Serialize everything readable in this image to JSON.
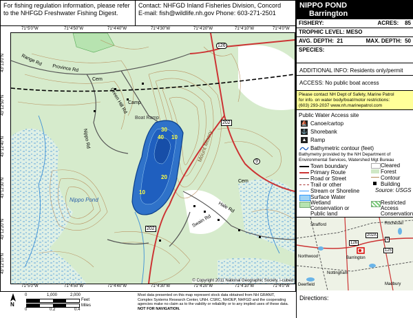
{
  "header": {
    "reg_line1": "For fishing regulation information, please refer",
    "reg_line2": "to the NHFGD Freshwater Fishing Digest.",
    "contact_line1": "Contact: NHFGD Inland Fisheries Division, Concord",
    "contact_line2": "E-mail: fish@wildlife.nh.gov Phone: 603-271-2501"
  },
  "pond": {
    "name": "NIPPO POND",
    "town": "Barrington",
    "fishery_label": "FISHERY:",
    "fishery_value": "",
    "acres_label": "ACRES:",
    "acres_value": "85",
    "trophic_label": "TROPHIC LEVEL:",
    "trophic_value": "MESO",
    "avg_depth_label": "AVG. DEPTH:",
    "avg_depth_value": "21",
    "max_depth_label": "MAX. DEPTH:",
    "max_depth_value": "50",
    "species_label": "SPECIES:"
  },
  "info": {
    "additional": "ADDITIONAL INFO: Residents only/permit",
    "access": "ACCESS: No public boat access",
    "safety_line1": "Please contact NH Dept of Safety, Marine Patrol",
    "safety_line2": "for info. on water body/boat/motor restrictions:",
    "safety_line3": "(603) 293-2037    www.nh.marinepatrol.com"
  },
  "legend": {
    "access_title": "Public Water Access site",
    "canoe": "Canoe/cartop",
    "shorebank": "Shorebank",
    "ramp": "Ramp",
    "bathy": "Bathymetric contour (feet)",
    "bathy_credit1": "Bathymetry provided by the NH Department of",
    "bathy_credit2": "Environmental Services, Watershed Mgt Bureau",
    "town_boundary": "Town boundary",
    "primary_route": "Primary Route",
    "road": "Road or Street",
    "trail": "Trail or other",
    "stream": "Stream or Shoreline",
    "surface_water": "Surface Water",
    "wetland1": "Wetland",
    "wetland2": "Conservation or",
    "wetland3": "Public land",
    "cleared": "Cleared",
    "forest": "Forest",
    "contour": "Contour",
    "building": "Building",
    "source": "Source: USGS",
    "restricted1": "Restricted",
    "restricted2": "Access",
    "restricted3": "Conservation"
  },
  "map": {
    "coords_top": [
      "71°5'0\"W",
      "71°4'50\"W",
      "71°4'40\"W",
      "71°4'30\"W",
      "71°4'20\"W",
      "71°4'10\"W",
      "71°4'0\"W"
    ],
    "coords_bottom": [
      "71°5'0\"W",
      "71°4'50\"W",
      "71°4'40\"W",
      "71°4'30\"W",
      "71°4'20\"W",
      "71°4'10\"W",
      "71°4'0\"W"
    ],
    "coords_left": [
      "43°13'0\"N",
      "43°12'50\"N",
      "43°12'40\"N",
      "43°12'30\"N",
      "43°12'20\"N",
      "43°12'10\"N"
    ],
    "depths": [
      "30",
      "40",
      "10",
      "20",
      "10"
    ],
    "labels": {
      "pond": "Nippo Pond",
      "mount": "Mount Misery",
      "cem1": "Cem",
      "cem2": "Cem",
      "camp": "Camp",
      "route202": "202",
      "route126": "126",
      "route9": "9",
      "route202b": "202",
      "roads": [
        "Province Rd",
        "Range Rd",
        "Hale Rd",
        "Swain Rd",
        "Nippo Rd",
        "Green Hill Rd",
        "Boat Ramp"
      ]
    },
    "copyright": "© Copyright 2011 National Geographic Society, i-cubed"
  },
  "inset": {
    "routes": [
      "126",
      "202A",
      "9",
      "125"
    ],
    "towns": [
      "Strafford",
      "Rochester",
      "Barrington",
      "Northwood",
      "Nottingham",
      "Deerfield",
      "Madbury"
    ]
  },
  "footer": {
    "north": "N",
    "scale_feet": [
      "0",
      "1,000",
      "2,000"
    ],
    "feet": "Feet",
    "scale_miles": [
      "0",
      "0.2",
      "0.4"
    ],
    "miles": "Miles",
    "disclaimer1": "Most data presented on this map represent stock data obtained from NH GRANIT,",
    "disclaimer2": "Complex Systems Research Center, UNH.  CSRC, NHOEP, NHFGD and the cooperating",
    "disclaimer3": "agencies make no claim as to the validity or reliability or to any implied uses of these data.",
    "disclaimer4": "NOT FOR NAVIGATION.",
    "directions": "Directions:"
  }
}
